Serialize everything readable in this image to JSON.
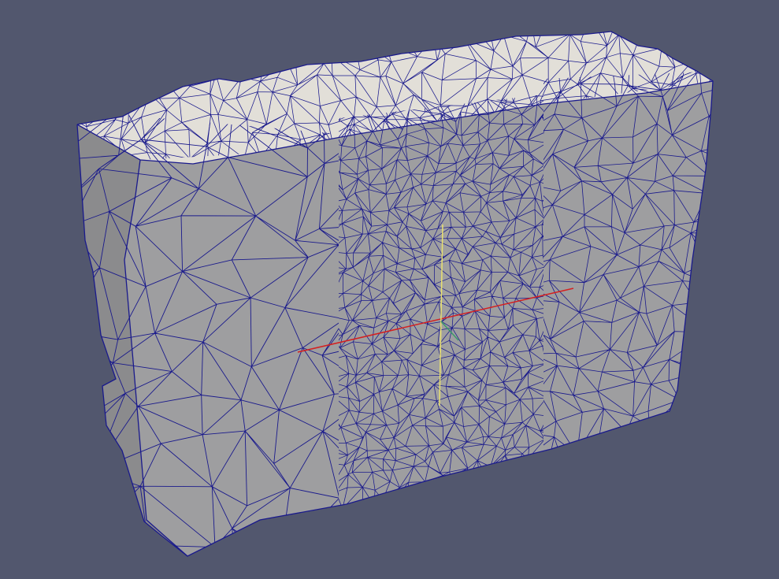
{
  "viewport": {
    "background_color": "#52576e",
    "mesh": {
      "wireframe_color": "#1a1a8c",
      "front_face_color": "#9e9ea0",
      "left_face_color": "#8b8b8d",
      "top_face_color": "#e2dfd8",
      "density": {
        "left_zone": "coarse",
        "center_zone": "fine",
        "right_zone": "medium"
      }
    },
    "center_axes": {
      "x_axis_color": "#d42020",
      "y_axis_color": "#e8e070",
      "z_axis_color": "#3a9a6a"
    }
  }
}
